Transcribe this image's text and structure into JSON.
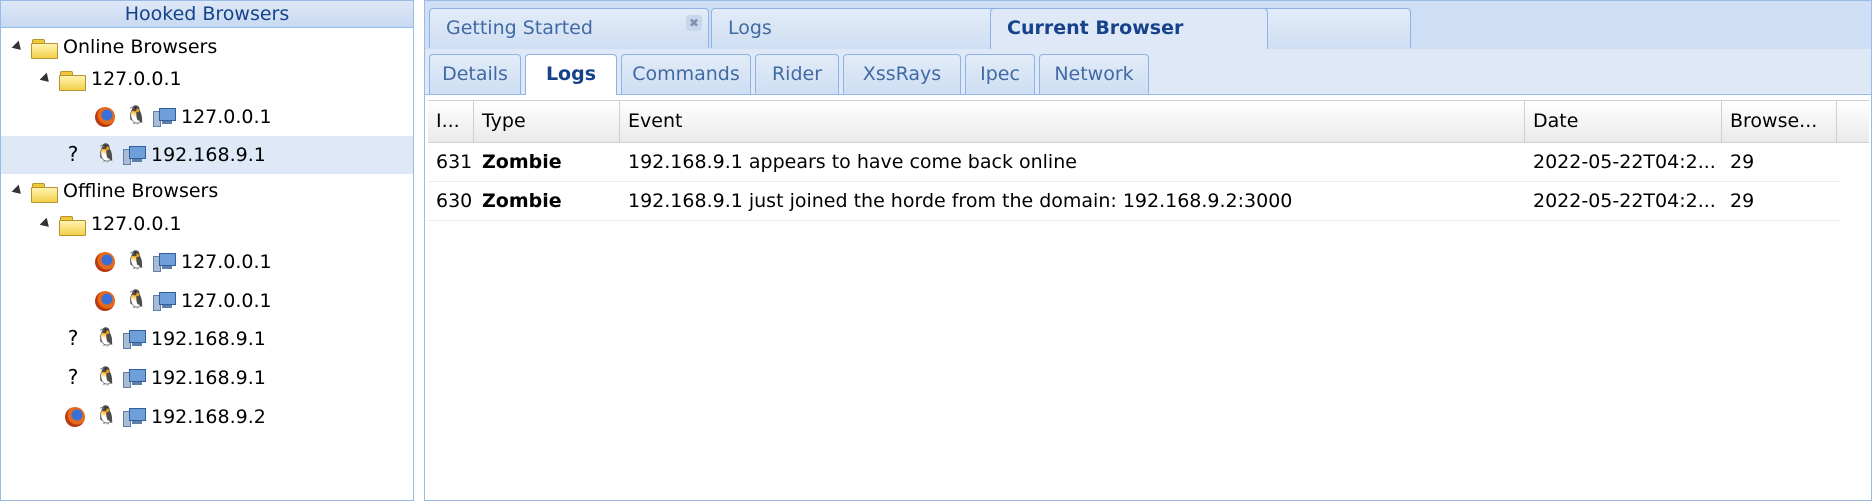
{
  "left_panel": {
    "title": "Hooked Browsers",
    "online": {
      "label": "Online Browsers",
      "group": "127.0.0.1",
      "items": [
        "127.0.0.1",
        "192.168.9.1"
      ]
    },
    "offline": {
      "label": "Offline Browsers",
      "group": "127.0.0.1",
      "items": [
        "127.0.0.1",
        "127.0.0.1",
        "192.168.9.1",
        "192.168.9.1",
        "192.168.9.2"
      ]
    }
  },
  "top_tabs": [
    "Getting Started",
    "Logs",
    "Current Browser"
  ],
  "top_tab_close": "✖",
  "sub_tabs": [
    "Details",
    "Logs",
    "Commands",
    "Rider",
    "XssRays",
    "Ipec",
    "Network"
  ],
  "grid": {
    "columns": [
      "I...",
      "Type",
      "Event",
      "Date",
      "Browse..."
    ],
    "rows": [
      {
        "id": "631",
        "type": "Zombie",
        "event": "192.168.9.1 appears to have come back online",
        "date": "2022-05-22T04:2...",
        "browser": "29"
      },
      {
        "id": "630",
        "type": "Zombie",
        "event": "192.168.9.1 just joined the horde from the domain: 192.168.9.2:3000",
        "date": "2022-05-22T04:2...",
        "browser": "29"
      }
    ]
  },
  "icons": {
    "firefox": "firefox-icon",
    "linux": "linux-tux-icon",
    "computer": "computer-icon",
    "unknown": "unknown-browser-icon"
  },
  "glyphs": {
    "tux": "🐧",
    "unknown": "?"
  }
}
